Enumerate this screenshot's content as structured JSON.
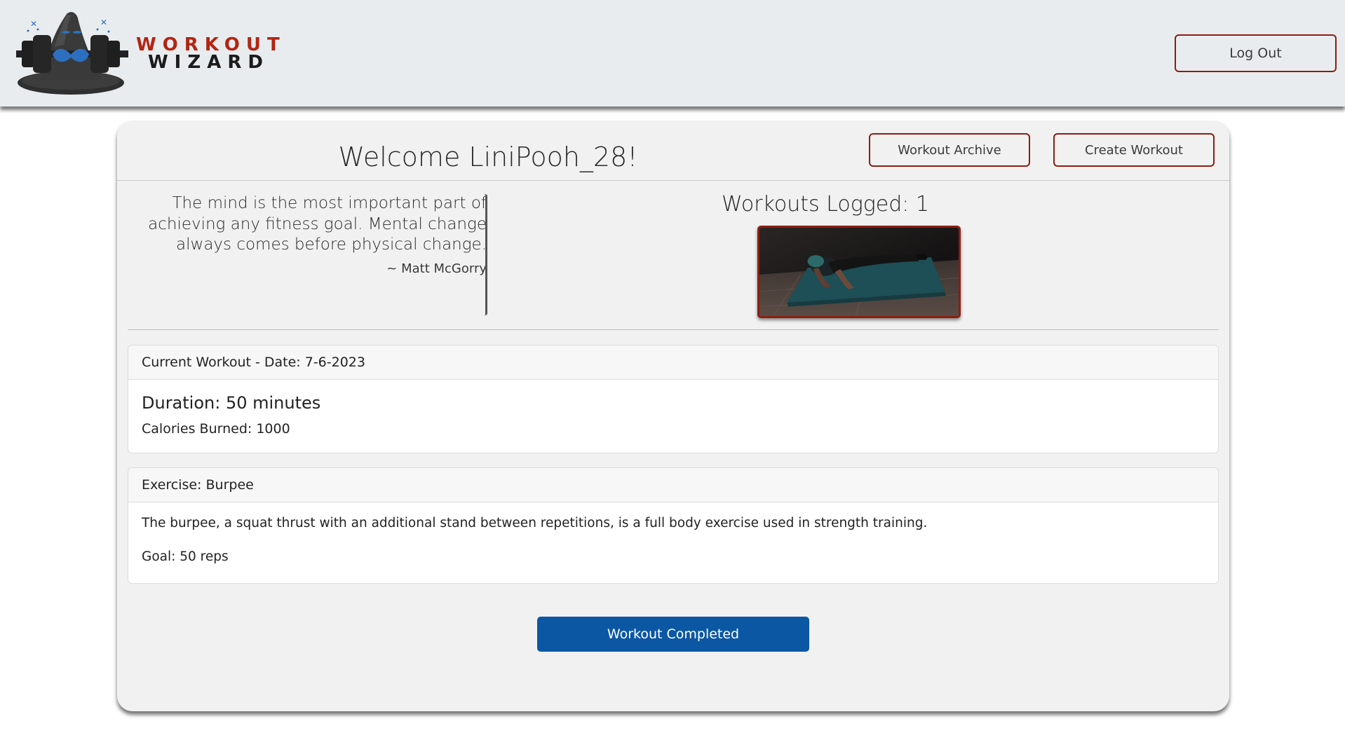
{
  "header": {
    "brand_line1": "WORKOUT",
    "brand_line2": "WIZARD",
    "logo_icon": "wizard-hat-dumbbell-icon",
    "logout_label": "Log Out"
  },
  "dashboard": {
    "welcome": "Welcome LiniPooh_28!",
    "archive_label": "Workout Archive",
    "create_label": "Create Workout",
    "quote": {
      "text": "The mind is the most important part of achieving any fitness goal. Mental change always comes before physical change.",
      "author": "~ Matt McGorry"
    },
    "workouts_logged": "Workouts Logged: 1",
    "photo_subject": "person-doing-pushup-on-mat-image"
  },
  "current_workout": {
    "header": "Current Workout - Date: 7-6-2023",
    "duration": "Duration: 50 minutes",
    "calories": "Calories Burned: 1000"
  },
  "exercise": {
    "header": "Exercise: Burpee",
    "description": "The burpee, a squat thrust with an additional stand between repetitions, is a full body exercise used in strength training.",
    "goal": "Goal: 50 reps"
  },
  "actions": {
    "complete_label": "Workout Completed"
  },
  "colors": {
    "accent_red": "#8b1e12",
    "brand_red": "#b22512",
    "primary_blue": "#0b57a4",
    "navbar_bg": "#e9ecef",
    "card_bg": "#f1f1f1"
  }
}
